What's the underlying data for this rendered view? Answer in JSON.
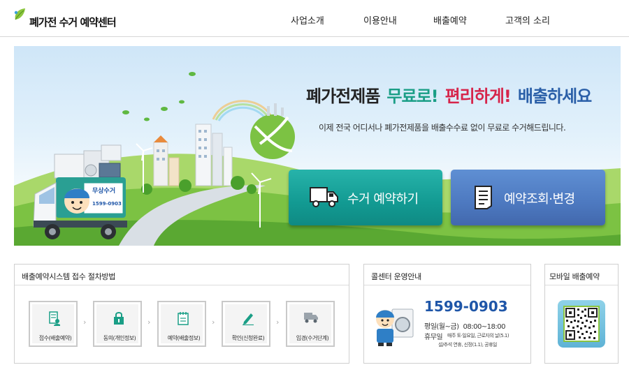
{
  "header": {
    "logo_text": "폐가전 수거 예약센터",
    "nav": [
      "사업소개",
      "이용안내",
      "배출예약",
      "고객의 소리"
    ]
  },
  "banner": {
    "headline_1": "폐가전제품",
    "headline_2": "무료로!",
    "headline_3": "편리하게!",
    "headline_4": "배출하세요",
    "subline": "이제 전국 어디서나 폐가전제품을 배출수수료 없이 무료로 수거해드립니다.",
    "truck_text": "무상수거",
    "truck_phone": "1599-0903",
    "btn_pickup": "수거 예약하기",
    "btn_check": "예약조회·변경"
  },
  "procedure": {
    "title": "배출예약시스템 접수 절차방법",
    "steps": [
      {
        "label": "접수(배출예약)",
        "icon": "document-user-icon"
      },
      {
        "label": "동의(개인정보)",
        "icon": "lock-icon"
      },
      {
        "label": "예약(배출정보)",
        "icon": "notepad-icon"
      },
      {
        "label": "확인(신청완료)",
        "icon": "pencil-icon"
      },
      {
        "label": "입경(수거단계)",
        "icon": "truck-icon"
      }
    ]
  },
  "callcenter": {
    "title": "콜센터 운영안내",
    "phone": "1599-0903",
    "weekday_label": "평일(월~금)",
    "weekday_hours": "08:00~18:00",
    "holiday_label": "휴무일",
    "holiday_1": "매주 토·일요일, 근로자의 날(5.1)",
    "holiday_2": "설/추석 연휴, 신정(1.1), 공휴일"
  },
  "mobile": {
    "title": "모바일 배출예약",
    "icon": "qr-code-icon"
  },
  "colors": {
    "teal": "#129a92",
    "blue": "#4d79c0",
    "phone_blue": "#1f56a8",
    "red": "#d6244a"
  }
}
